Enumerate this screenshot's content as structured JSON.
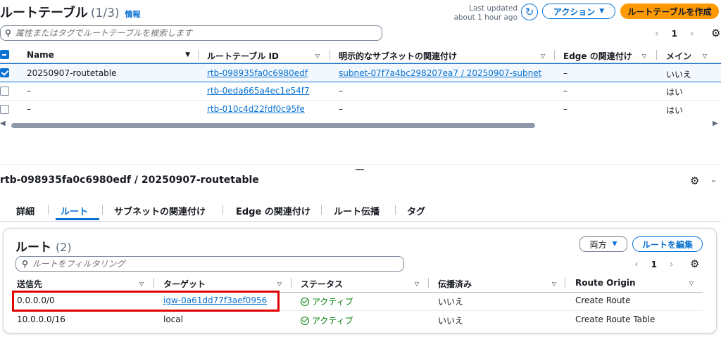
{
  "top": {
    "title": "ルートテーブル",
    "count": "(1/3)",
    "info": "情報",
    "last_updated_label": "Last updated",
    "last_updated_value": "about 1 hour ago",
    "actions_label": "アクション",
    "create_label": "ルートテーブルを作成",
    "search_placeholder": "属性またはタグでルートテーブルを検索します",
    "page": "1",
    "columns": [
      "Name",
      "ルートテーブル ID",
      "明示的なサブネットの関連付け",
      "Edge の関連付け",
      "メイン"
    ],
    "rows": [
      {
        "name": "20250907-routetable",
        "id": "rtb-098935fa0c6980edf",
        "subnet": "subnet-07f7a4bc298207ea7 / 20250907-subnet",
        "edge": "–",
        "main": "いいえ",
        "selected": true
      },
      {
        "name": "–",
        "id": "rtb-0eda665a4ec1e54f7",
        "subnet": "–",
        "edge": "–",
        "main": "はい",
        "selected": false
      },
      {
        "name": "–",
        "id": "rtb-010c4d22fdf0c95fe",
        "subnet": "–",
        "edge": "–",
        "main": "はい",
        "selected": false
      }
    ]
  },
  "detail": {
    "title": "rtb-098935fa0c6980edf / 20250907-routetable",
    "tabs": [
      "詳細",
      "ルート",
      "サブネットの関連付け",
      "Edge の関連付け",
      "ルート伝播",
      "タグ"
    ],
    "active_tab": 1,
    "routes_title": "ルート",
    "routes_count": "(2)",
    "filter_label": "両方",
    "edit_label": "ルートを編集",
    "filter_placeholder": "ルートをフィルタリング",
    "page": "1",
    "columns": [
      "送信先",
      "ターゲット",
      "ステータス",
      "伝播済み",
      "Route Origin"
    ],
    "rows": [
      {
        "dest": "0.0.0.0/0",
        "target": "igw-0a61dd77f3aef0956",
        "target_link": true,
        "status": "アクティブ",
        "propagated": "いいえ",
        "origin": "Create Route"
      },
      {
        "dest": "10.0.0.0/16",
        "target": "local",
        "target_link": false,
        "status": "アクティブ",
        "propagated": "いいえ",
        "origin": "Create Route Table"
      }
    ]
  },
  "colors": {
    "accent": "#0972d3",
    "primary_button": "#ff9900",
    "success": "#037f0c",
    "highlight_box": "#e00000",
    "selected_row": "#f2f8fd"
  }
}
